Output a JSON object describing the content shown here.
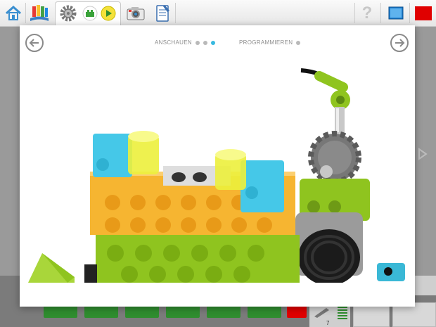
{
  "toolbar": {
    "icons": [
      "home-icon",
      "project-flags-icon",
      "gear-tab-icon",
      "green-block-icon",
      "play-icon",
      "camera-icon",
      "notebook-icon",
      "help-icon",
      "screen-icon",
      "stop-icon"
    ],
    "help_glyph": "?"
  },
  "modal": {
    "step_label_1": "ANSCHAUEN",
    "step_label_2": "PROGRAMMIEREN",
    "step_dots_1": 3,
    "active_dot": 3,
    "step_dots_2": 1
  },
  "palette": {
    "counter": "7"
  },
  "colors": {
    "accent_dot": "#38b9e0",
    "stop": "#e00000"
  }
}
